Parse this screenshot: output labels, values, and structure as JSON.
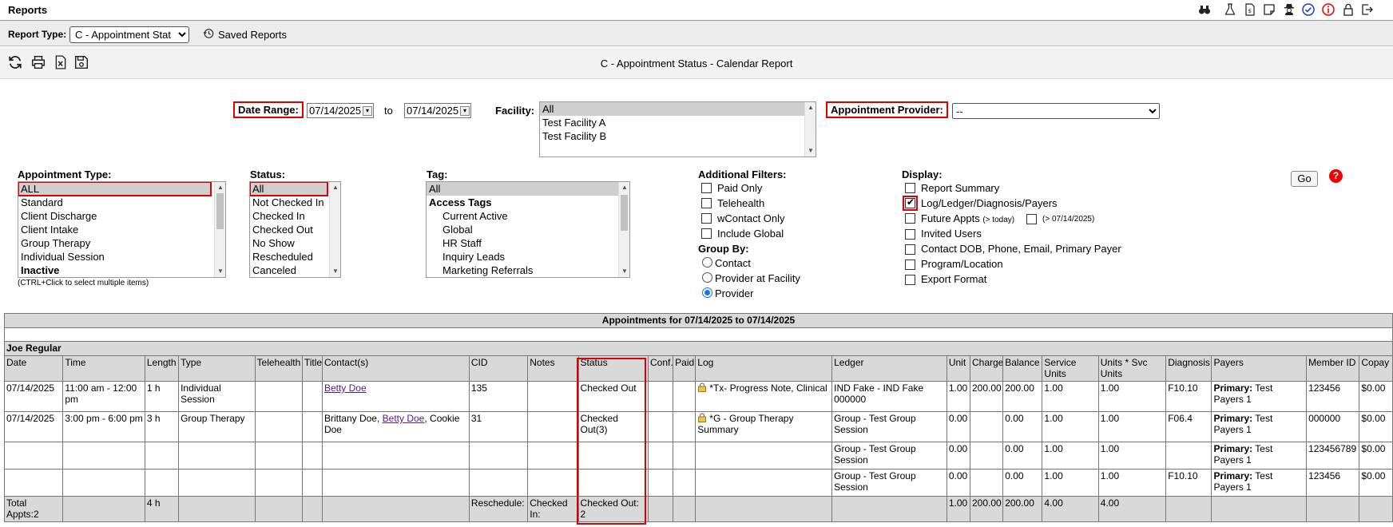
{
  "app": {
    "title": "Reports"
  },
  "top_icons": [
    "binoculars-icon",
    "flask-icon",
    "document-dollar-icon",
    "note-icon",
    "user-secret-icon",
    "check-circle-icon",
    "info-circle-icon",
    "lock-icon",
    "logout-icon"
  ],
  "typebar": {
    "label": "Report Type:",
    "selected": "C - Appointment Stat",
    "saved_reports": "Saved Reports"
  },
  "toolbar": {
    "report_title": "C - Appointment Status - Calendar Report"
  },
  "filters": {
    "date_range_label": "Date Range:",
    "date_from": "07/14/2025",
    "to_label": "to",
    "date_to": "07/14/2025",
    "facility_label": "Facility:",
    "facility_options": [
      "All",
      "Test Facility A",
      "Test Facility B"
    ],
    "provider_label": "Appointment Provider:",
    "provider_value": "--",
    "appt_type_label": "Appointment Type:",
    "appt_type_options": [
      "ALL",
      "Standard",
      "Client Discharge",
      "Client Intake",
      "Group Therapy",
      "Individual Session",
      "Inactive"
    ],
    "ctrl_hint": "(CTRL+Click to select multiple items)",
    "status_label": "Status:",
    "status_options": [
      "All",
      "Not Checked In",
      "Checked In",
      "Checked Out",
      "No Show",
      "Rescheduled",
      "Canceled"
    ],
    "tag_label": "Tag:",
    "tag_options": [
      "All",
      "Access Tags",
      "Current Active",
      "Global",
      "HR Staff",
      "Inquiry Leads",
      "Marketing Referrals"
    ],
    "additional_label": "Additional Filters:",
    "additional": [
      "Paid Only",
      "Telehealth",
      "wContact Only",
      "Include Global"
    ],
    "group_by_label": "Group By:",
    "group_by": [
      "Contact",
      "Provider at Facility",
      "Provider"
    ],
    "group_by_selected": "Provider",
    "display_label": "Display:",
    "display": {
      "report_summary": "Report Summary",
      "log_ledger": "Log/Ledger/Diagnosis/Payers",
      "future_appts": "Future Appts",
      "future_today": "(> today)",
      "future_date": "(> 07/14/2025)",
      "invited_users": "Invited Users",
      "contact_dob": "Contact DOB, Phone, Email, Primary Payer",
      "program_location": "Program/Location",
      "export_format": "Export Format"
    },
    "go": "Go",
    "help": "?"
  },
  "table": {
    "caption": "Appointments for 07/14/2025 to 07/14/2025",
    "group": "Joe Regular",
    "headers": [
      "Date",
      "Time",
      "Length",
      "Type",
      "Telehealth",
      "Title",
      "Contact(s)",
      "CID",
      "Notes",
      "Status",
      "Conf.",
      "Paid",
      "Log",
      "Ledger",
      "Unit",
      "Charge",
      "Balance",
      "Service Units",
      "Units * Svc Units",
      "Diagnosis",
      "Payers",
      "Member ID",
      "Copay"
    ],
    "rows": [
      {
        "date": "07/14/2025",
        "time": "11:00 am - 12:00 pm",
        "length": "1 h",
        "type": "Individual Session",
        "telehealth": "",
        "title": "",
        "contact_links": [
          "Betty Doe"
        ],
        "contact_text": "",
        "cid": "135",
        "notes": "",
        "status": "Checked Out",
        "conf": "",
        "paid": "",
        "log": "*Tx- Progress Note, Clinical",
        "ledger": "IND Fake - IND Fake 000000",
        "unit": "1.00",
        "charge": "200.00",
        "balance": "200.00",
        "service_units": "1.00",
        "units_svc": "1.00",
        "diagnosis": "F10.10",
        "payer_label": "Primary:",
        "payer": "Test Payers 1",
        "member_id": "123456",
        "copay": "$0.00"
      },
      {
        "date": "07/14/2025",
        "time": "3:00 pm - 6:00 pm",
        "length": "3 h",
        "type": "Group Therapy",
        "telehealth": "",
        "title": "",
        "contact_pre": "Brittany Doe, ",
        "contact_link": "Betty Doe",
        "contact_post": ", Cookie Doe",
        "cid": "31",
        "notes": "",
        "status": "Checked Out(3)",
        "conf": "",
        "paid": "",
        "log": "*G - Group Therapy Summary",
        "ledger": "Group - Test Group Session",
        "unit": "0.00",
        "charge": "",
        "balance": "0.00",
        "service_units": "1.00",
        "units_svc": "1.00",
        "diagnosis": "F06.4",
        "payer_label": "Primary:",
        "payer": "Test Payers 1",
        "member_id": "000000",
        "copay": "$0.00"
      },
      {
        "ledger": "Group - Test Group Session",
        "unit": "0.00",
        "charge": "",
        "balance": "0.00",
        "service_units": "1.00",
        "units_svc": "1.00",
        "diagnosis": "",
        "payer_label": "Primary:",
        "payer": "Test Payers 1",
        "member_id": "123456789",
        "copay": "$0.00"
      },
      {
        "ledger": "Group - Test Group Session",
        "unit": "0.00",
        "charge": "",
        "balance": "0.00",
        "service_units": "1.00",
        "units_svc": "1.00",
        "diagnosis": "F10.10",
        "payer_label": "Primary:",
        "payer": "Test Payers 1",
        "member_id": "123456",
        "copay": "$0.00"
      }
    ],
    "total": {
      "label": "Total Appts:2",
      "length": "4 h",
      "reschedule": "Reschedule:",
      "checked_in": "Checked In:",
      "checked_out": "Checked Out: 2",
      "unit": "1.00",
      "charge": "200.00",
      "balance": "200.00",
      "service_units": "4.00",
      "units_svc": "4.00"
    }
  },
  "colors": {
    "highlight": "#dd0000",
    "link": "#551a8b",
    "header_bg": "#d9d9d9",
    "radio": "#1a73e8"
  }
}
